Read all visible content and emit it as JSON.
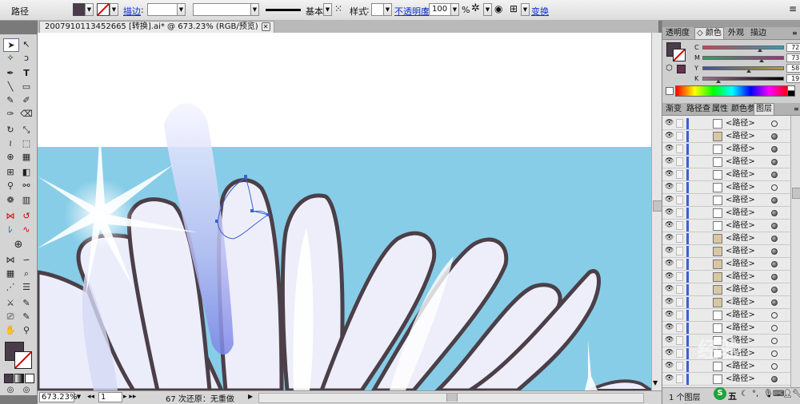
{
  "control_bar": {
    "object_type": "路径",
    "fill_color": "#4a3c4a",
    "stroke_label": "描边",
    "stroke_weight": "",
    "brush_preset": "基本",
    "style_label": "样式",
    "opacity_label": "不透明度",
    "opacity_value": "100",
    "percent": "%",
    "transform_label": "变换"
  },
  "document_tab": {
    "title": "2007910113452665 [转换].ai* @ 673.23% (RGB/预览)",
    "close": "✕"
  },
  "toolbox": {
    "fill_color": "#4a3c4a",
    "stroke_color": "#ffffff"
  },
  "canvas": {
    "background_color": "#87cde8",
    "artboard_color": "#ffffff",
    "petal_outline_color": "#4b3f48",
    "petal_fill_color": "#eeeefb",
    "petal_shade_color": "#c9ccf2"
  },
  "status_bar": {
    "zoom": "673.23%",
    "artboard_number": "1",
    "undo_info": "67 次还原：无重做"
  },
  "color_panel": {
    "tabs": [
      "透明度",
      "颜色",
      "外观",
      "描边"
    ],
    "active_tab": "颜色",
    "channels": [
      {
        "label": "C",
        "value": "72.05",
        "fraction": 0.7205
      },
      {
        "label": "M",
        "value": "73.66",
        "fraction": 0.7366
      },
      {
        "label": "Y",
        "value": "58.04",
        "fraction": 0.5804
      },
      {
        "label": "K",
        "value": "19.68",
        "fraction": 0.1968
      }
    ],
    "percent": "%"
  },
  "layers_panel": {
    "tabs": [
      "渐变",
      "路径查",
      "属性",
      "颜色参",
      "图层"
    ],
    "active_tab": "图层",
    "rows": [
      {
        "name": "<路径>",
        "thumb": "white",
        "target": "empty"
      },
      {
        "name": "<路径>",
        "thumb": "tan",
        "target": "filled"
      },
      {
        "name": "<路径>",
        "thumb": "white",
        "target": "filled"
      },
      {
        "name": "<路径>",
        "thumb": "white",
        "target": "filled"
      },
      {
        "name": "<路径>",
        "thumb": "white",
        "target": "filled"
      },
      {
        "name": "<路径>",
        "thumb": "white",
        "target": "empty"
      },
      {
        "name": "<路径>",
        "thumb": "white",
        "target": "filled"
      },
      {
        "name": "<路径>",
        "thumb": "white",
        "target": "filled"
      },
      {
        "name": "<路径>",
        "thumb": "white",
        "target": "filled"
      },
      {
        "name": "<路径>",
        "thumb": "tan",
        "target": "filled"
      },
      {
        "name": "<路径>",
        "thumb": "tan",
        "target": "filled"
      },
      {
        "name": "<路径>",
        "thumb": "tan",
        "target": "filled"
      },
      {
        "name": "<路径>",
        "thumb": "tan",
        "target": "filled"
      },
      {
        "name": "<路径>",
        "thumb": "tan",
        "target": "filled"
      },
      {
        "name": "<路径>",
        "thumb": "tan",
        "target": "filled"
      },
      {
        "name": "<路径>",
        "thumb": "white",
        "target": "empty"
      },
      {
        "name": "<路径>",
        "thumb": "white",
        "target": "empty"
      },
      {
        "name": "<路径>",
        "thumb": "white",
        "target": "empty"
      },
      {
        "name": "<路径>",
        "thumb": "white",
        "target": "empty"
      },
      {
        "name": "<路径>",
        "thumb": "white",
        "target": "empty"
      },
      {
        "name": "<路径>",
        "thumb": "white",
        "target": "filled"
      }
    ],
    "footer_label": "1 个图层"
  },
  "watermark_text": "经验",
  "taskbar_ime": "五"
}
